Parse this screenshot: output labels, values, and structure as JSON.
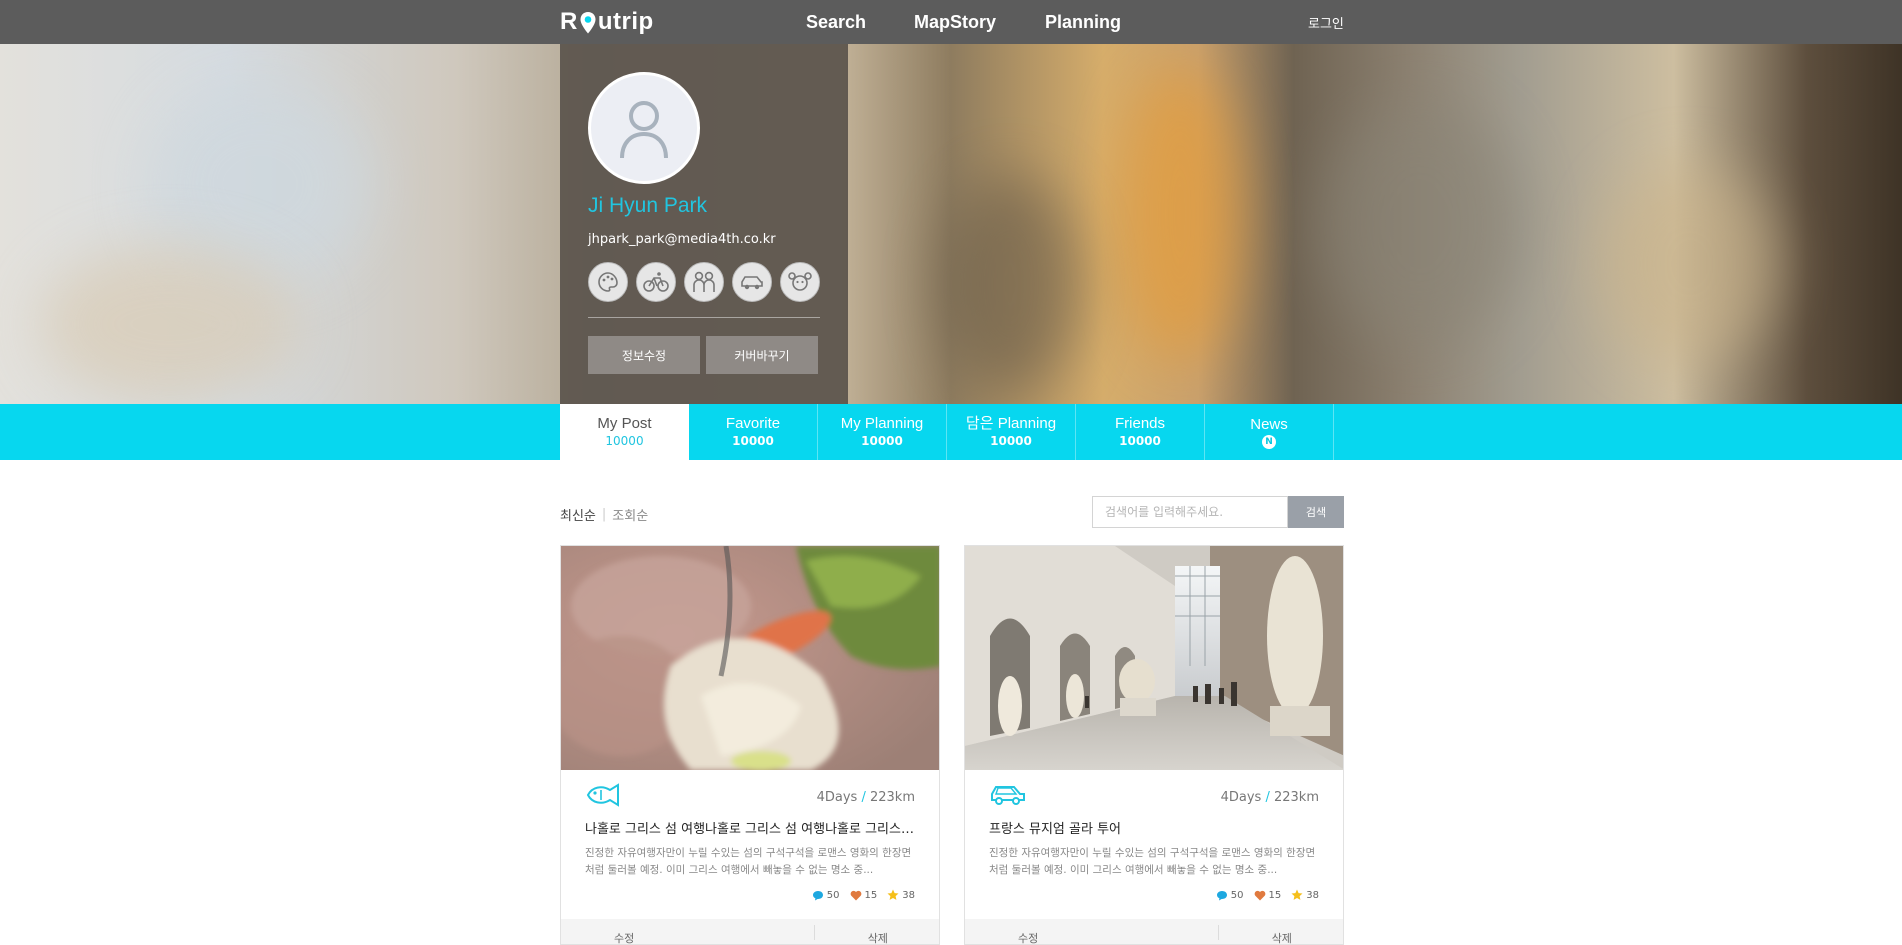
{
  "header": {
    "logo": {
      "pre": "R",
      "post": "utrip"
    },
    "nav": [
      {
        "label": "Search"
      },
      {
        "label": "MapStory"
      },
      {
        "label": "Planning"
      }
    ],
    "login": "로그인"
  },
  "profile": {
    "name": "Ji Hyun Park",
    "email": "jhpark_park@media4th.co.kr",
    "badges": [
      "palette-icon",
      "bicycle-icon",
      "couple-icon",
      "car-icon",
      "hamster-icon"
    ],
    "edit_info_label": "정보수정",
    "change_cover_label": "커버바꾸기"
  },
  "tabs": [
    {
      "label": "My Post",
      "count": "10000",
      "active": true
    },
    {
      "label": "Favorite",
      "count": "10000"
    },
    {
      "label": "My Planning",
      "count": "10000"
    },
    {
      "label": "담은 Planning",
      "count": "10000"
    },
    {
      "label": "Friends",
      "count": "10000"
    },
    {
      "label": "News",
      "badge": "N"
    }
  ],
  "toolbar": {
    "sort_latest": "최신순",
    "sort_views": "조회순",
    "search_placeholder": "검색어를 입력해주세요.",
    "search_button": "검색"
  },
  "cards": [
    {
      "transport_icon": "fish-icon",
      "days": "4Days",
      "distance": "223km",
      "title": "나홀로 그리스 섬 여행나홀로 그리스 섬 여행나홀로 그리스 섬 여행",
      "description": "진정한 자유여행자만이 누릴 수있는 섬의 구석구석을 로맨스 영화의 한장면처럼 둘러볼 예정. 이미 그리스 여행에서 빼놓을 수 없는 명소 중...",
      "comments": "50",
      "likes": "15",
      "stars": "38",
      "edit_label": "수정",
      "delete_label": "삭제"
    },
    {
      "transport_icon": "car-icon",
      "days": "4Days",
      "distance": "223km",
      "title": "프랑스 뮤지엄 골라 투어",
      "description": "진정한 자유여행자만이 누릴 수있는 섬의 구석구석을 로맨스 영화의 한장면처럼 둘러볼 예정. 이미 그리스 여행에서 빼놓을 수 없는 명소 중...",
      "comments": "50",
      "likes": "15",
      "stars": "38",
      "edit_label": "수정",
      "delete_label": "삭제"
    }
  ],
  "colors": {
    "accent": "#07d7ef",
    "topbar": "#5c5c5c",
    "name": "#21c5e0"
  }
}
